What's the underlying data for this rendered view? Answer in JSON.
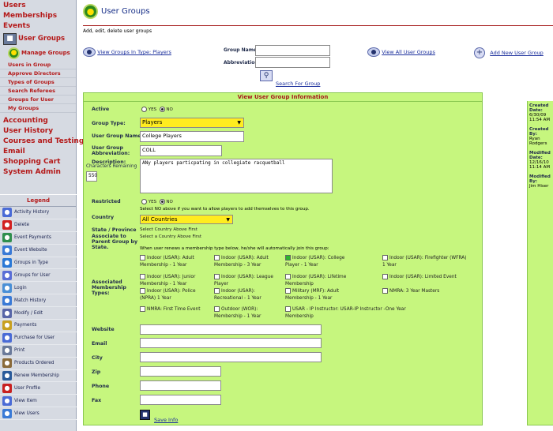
{
  "nav": {
    "items": [
      "Users",
      "Memberships",
      "Events"
    ],
    "section": "User Groups",
    "submenu_head": "Manage Groups",
    "submenu": [
      "Users in Group",
      "Approve Directors",
      "Types of Groups",
      "Search Referees",
      "Groups for User",
      "My Groups"
    ],
    "items2": [
      "Accounting",
      "User History",
      "Courses and Testing",
      "Email",
      "Shopping Cart",
      "System Admin"
    ]
  },
  "legend": {
    "title": "Legend",
    "items": [
      {
        "label": "Activity History",
        "icon": "history-icon",
        "color": "#4a6bd6"
      },
      {
        "label": "Delete",
        "icon": "delete-icon",
        "color": "#d22020"
      },
      {
        "label": "Event Payments",
        "icon": "event-payments-icon",
        "color": "#2f8f4e"
      },
      {
        "label": "Event Website",
        "icon": "website-icon",
        "color": "#3a7ad6"
      },
      {
        "label": "Groups in Type",
        "icon": "groups-icon",
        "color": "#2a78d6"
      },
      {
        "label": "Groups for User",
        "icon": "groups-user-icon",
        "color": "#5a6ed6"
      },
      {
        "label": "Login",
        "icon": "login-icon",
        "color": "#4a8fd6"
      },
      {
        "label": "Match History",
        "icon": "match-history-icon",
        "color": "#3a7ad6"
      },
      {
        "label": "Modify / Edit",
        "icon": "edit-icon",
        "color": "#5866a8"
      },
      {
        "label": "Payments",
        "icon": "payments-icon",
        "color": "#c8a020"
      },
      {
        "label": "Purchase for User",
        "icon": "purchase-icon",
        "color": "#4a6bd6"
      },
      {
        "label": "Print",
        "icon": "print-icon",
        "color": "#6a7a9a"
      },
      {
        "label": "Products Ordered",
        "icon": "products-icon",
        "color": "#8a6a3a"
      },
      {
        "label": "Renew Membership",
        "icon": "renew-icon",
        "color": "#2a5a9a"
      },
      {
        "label": "User Profile",
        "icon": "profile-icon",
        "color": "#c82020"
      },
      {
        "label": "View Item",
        "icon": "view-item-icon",
        "color": "#4a6bd6"
      },
      {
        "label": "View Users",
        "icon": "view-users-icon",
        "color": "#3a7ad6"
      }
    ]
  },
  "header": {
    "title": "User Groups",
    "description": "Add, edit, delete user groups"
  },
  "search": {
    "view_in_type": "View Groups In Type: Players",
    "group_name_label": "Group Name",
    "abbr_label": "Abbreviation",
    "view_all": "View All User Groups",
    "add_new": "Add New User Group",
    "search_btn": "Search For Group"
  },
  "form": {
    "title": "View User Group Information",
    "active_label": "Active",
    "yes": "YES",
    "no": "NO",
    "group_type_label": "Group Type:",
    "group_type": "Players",
    "name_label": "User Group Name:",
    "name": "College Players",
    "abbr_label": "User Group Abbreviation:",
    "abbr": "COLL",
    "desc_label": "Description:",
    "chars_label": "Characters Remaining",
    "chars": "550",
    "desc": "ANy players particpating in collegiate racquetball",
    "restricted_label": "Restricted",
    "restricted_note": "Select NO above if you want to allow players to add themselves to this group.",
    "country_label": "Country",
    "country": "All Countries",
    "state_label": "State / Province",
    "state_text": "Select Country Above First",
    "parent_label": "Associate to Parent Group by State.",
    "parent_text": "Select a Country Above First",
    "renew_note": "When user renews a membership type below, he/she will automatically join this group:",
    "memberships_label": "Associated Membership Types:",
    "memberships": [
      "Indoor (USAR): Adult Membership - 1 Year",
      "Indoor (USAR): Adult Membership - 3 Year",
      "Indoor (USAR): College Player - 1 Year",
      "Indoor (USAR): Firefighter (WFRA) 1 Year",
      "Indoor (USAR): Junior Membership - 1 Year",
      "Indoor (USAR): League Player",
      "Indoor (USAR): Lifetime Membership",
      "Indoor (USAR): Limited Event",
      "Indoor (USAR): Police (NPRA) 1 Year",
      "Indoor (USAR): Recreational - 1 Year",
      "Military (MRF): Adult Membership - 1 Year",
      "NMRA: 3 Year Masters",
      "NMRA: First Time Event",
      "Outdoor (WOR): Membership - 1 Year",
      "USAR - IP Instructor: USAR-IP Instructor -One Year Membership"
    ],
    "website_label": "Website",
    "email_label": "Email",
    "city_label": "City",
    "zip_label": "Zip",
    "phone_label": "Phone",
    "fax_label": "Fax",
    "save": "Save Info"
  },
  "meta": {
    "created_label": "Created Date:",
    "created": "6/30/09 11:54 AM",
    "created_by_label": "Created By:",
    "created_by": "Ryan Rodgers",
    "modified_label": "Modified Date:",
    "modified": "12/16/10 11:14 AM",
    "modified_by_label": "Modified By:",
    "modified_by": "Jim Hiser"
  }
}
